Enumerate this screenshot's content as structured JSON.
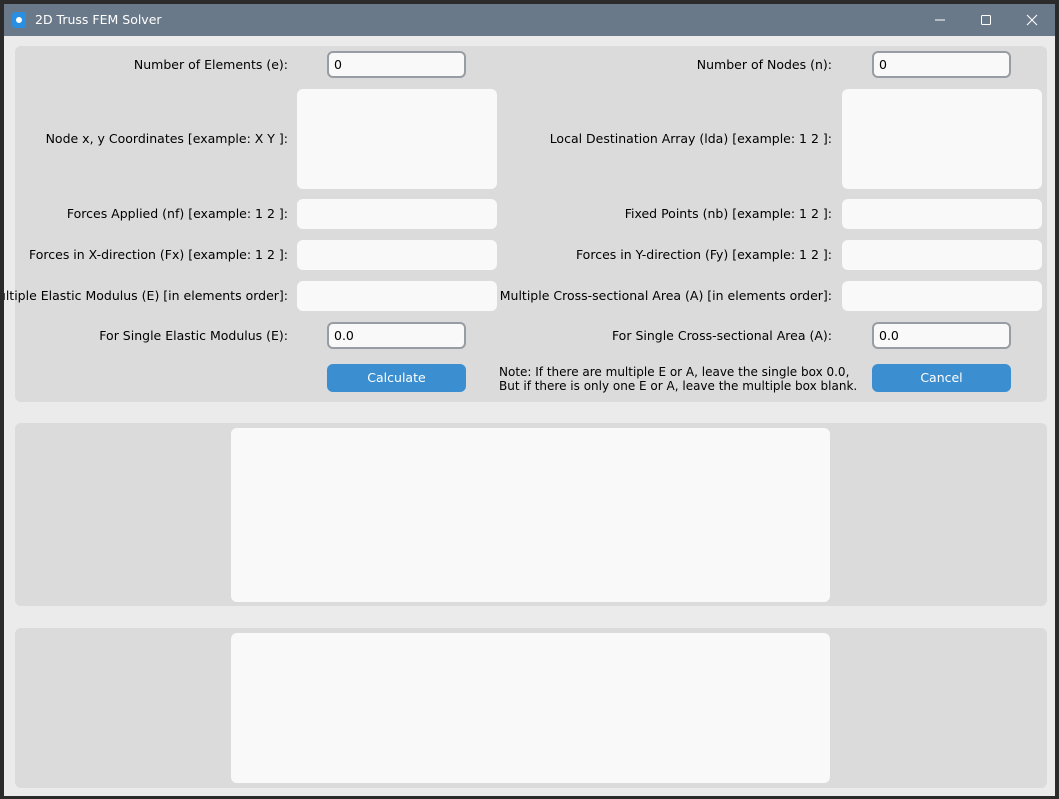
{
  "window": {
    "title": "2D Truss FEM Solver"
  },
  "form": {
    "num_elements": {
      "label": "Number of Elements (e):",
      "value": "0"
    },
    "num_nodes": {
      "label": "Number of Nodes (n):",
      "value": "0"
    },
    "node_coordinates": {
      "label": "Node x, y Coordinates [example: X Y ]:",
      "value": ""
    },
    "lda": {
      "label": "Local Destination Array (lda) [example: 1 2 ]:",
      "value": ""
    },
    "forces_applied": {
      "label": "Forces Applied (nf) [example: 1 2 ]:",
      "value": ""
    },
    "fixed_points": {
      "label": "Fixed Points (nb) [example: 1 2 ]:",
      "value": ""
    },
    "forces_x": {
      "label": "Forces in X-direction (Fx) [example: 1 2 ]:",
      "value": ""
    },
    "forces_y": {
      "label": "Forces in Y-direction (Fy) [example: 1 2 ]:",
      "value": ""
    },
    "multi_elastic": {
      "label": "Multiple Elastic Modulus (E) [in elements order]:",
      "value": ""
    },
    "multi_area": {
      "label": "Multiple Cross-sectional Area (A) [in elements order]:",
      "value": ""
    },
    "single_elastic": {
      "label": "For Single Elastic Modulus (E):",
      "value": "0.0"
    },
    "single_area": {
      "label": "For Single Cross-sectional Area (A):",
      "value": "0.0"
    },
    "note_line1": "Note: If there are multiple E or A, leave the single box 0.0,",
    "note_line2": "But if there is only one E or A, leave the multiple box blank."
  },
  "buttons": {
    "calculate": "Calculate",
    "cancel": "Cancel"
  },
  "output": {
    "results_text": "",
    "plot_text": ""
  },
  "colors": {
    "titlebar": "#6a7989",
    "accent_button": "#3b8ed0",
    "frame": "#dbdbdb",
    "background": "#ebebeb"
  },
  "icons": {
    "app": "app-icon",
    "minimize": "minimize-icon",
    "maximize": "maximize-icon",
    "close": "close-icon"
  }
}
